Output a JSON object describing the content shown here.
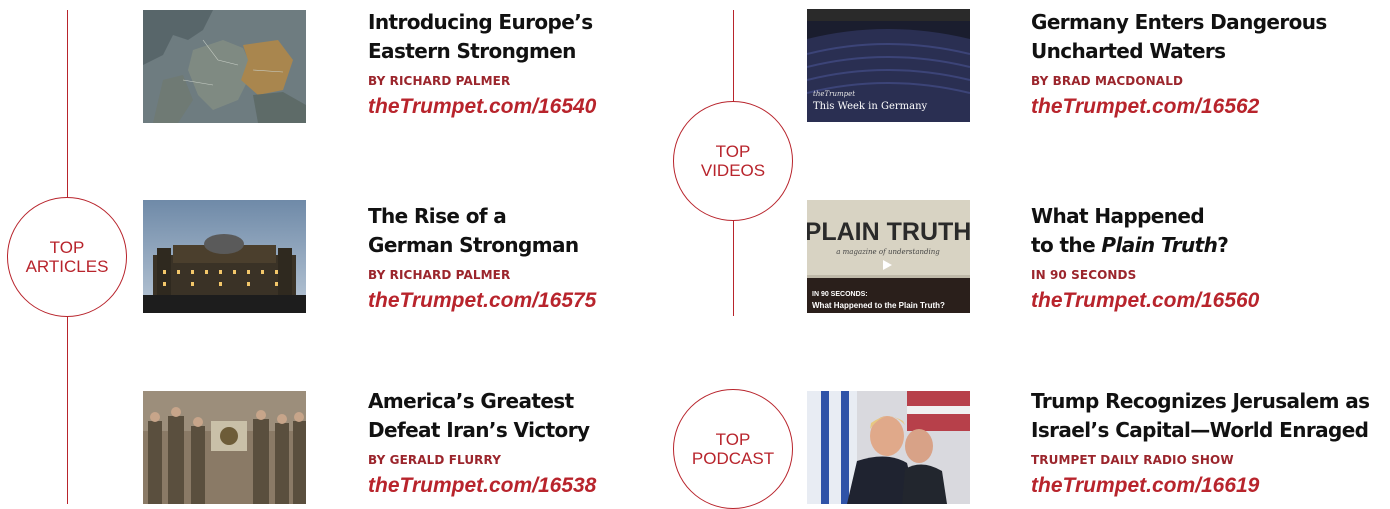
{
  "sections": {
    "articles": {
      "label_line1": "TOP",
      "label_line2": "ARTICLES"
    },
    "videos": {
      "label_line1": "TOP",
      "label_line2": "VIDEOS"
    },
    "podcast": {
      "label_line1": "TOP",
      "label_line2": "PODCAST"
    }
  },
  "articles": [
    {
      "title_line1": "Introducing Europe’s",
      "title_line2": "Eastern Strongmen",
      "byline": "BY RICHARD PALMER",
      "link": "theTrumpet.com/16540"
    },
    {
      "title_line1": "The Rise of a",
      "title_line2": "German Strongman",
      "byline": "BY RICHARD PALMER",
      "link": "theTrumpet.com/16575"
    },
    {
      "title_line1": "America’s Greatest",
      "title_line2": "Defeat Iran’s Victory",
      "byline": "BY GERALD FLURRY",
      "link": "theTrumpet.com/16538"
    }
  ],
  "videos": [
    {
      "title_line1": "Germany Enters Dangerous",
      "title_line2": "Uncharted Waters",
      "byline": "BY BRAD MACDONALD",
      "link": "theTrumpet.com/16562",
      "thumb_caption_line1": "theTrumpet",
      "thumb_caption_line2": "This Week in Germany"
    },
    {
      "title_line1": "What Happened",
      "title_line2_prefix": "to the ",
      "title_line2_italic": "Plain Truth",
      "title_line2_suffix": "?",
      "byline": "IN 90 SECONDS",
      "link": "theTrumpet.com/16560",
      "thumb_text": "PLAIN TRUTH",
      "thumb_subtext": "a magazine of understanding",
      "thumb_caption_line1": "IN 90 SECONDS:",
      "thumb_caption_line2": "What Happened to the Plain Truth?"
    }
  ],
  "podcast": [
    {
      "title_line1": "Trump Recognizes Jerusalem as",
      "title_line2": "Israel’s Capital—World Enraged",
      "byline": "TRUMPET DAILY RADIO SHOW",
      "link": "theTrumpet.com/16619"
    }
  ],
  "colors": {
    "accent": "#b8242c",
    "byline": "#9b252c",
    "title": "#111111"
  }
}
